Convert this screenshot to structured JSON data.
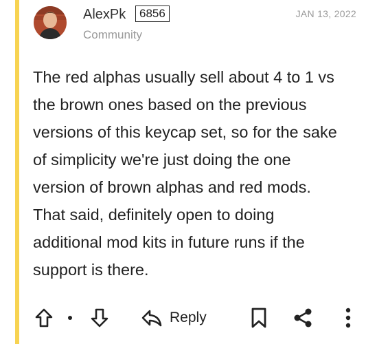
{
  "post": {
    "author": "AlexPk",
    "badge": "6856",
    "group": "Community",
    "date": "JAN 13, 2022",
    "body": "The red alphas usually sell about 4 to 1 vs\nthe brown ones based on the previous\nversions of this keycap set, so for the sake\nof simplicity we're just doing the one\nversion of brown alphas and red mods.\nThat said, definitely open to doing\nadditional mod kits in future runs if the\nsupport is there."
  },
  "actions": {
    "reply_label": "Reply",
    "icons": [
      "upvote-arrow-icon",
      "downvote-arrow-icon",
      "reply-arrow-icon",
      "bookmark-icon",
      "share-icon",
      "more-vertical-icon"
    ]
  },
  "colors": {
    "accent_bar": "#f7d352",
    "text": "#222222",
    "muted": "#999999"
  }
}
